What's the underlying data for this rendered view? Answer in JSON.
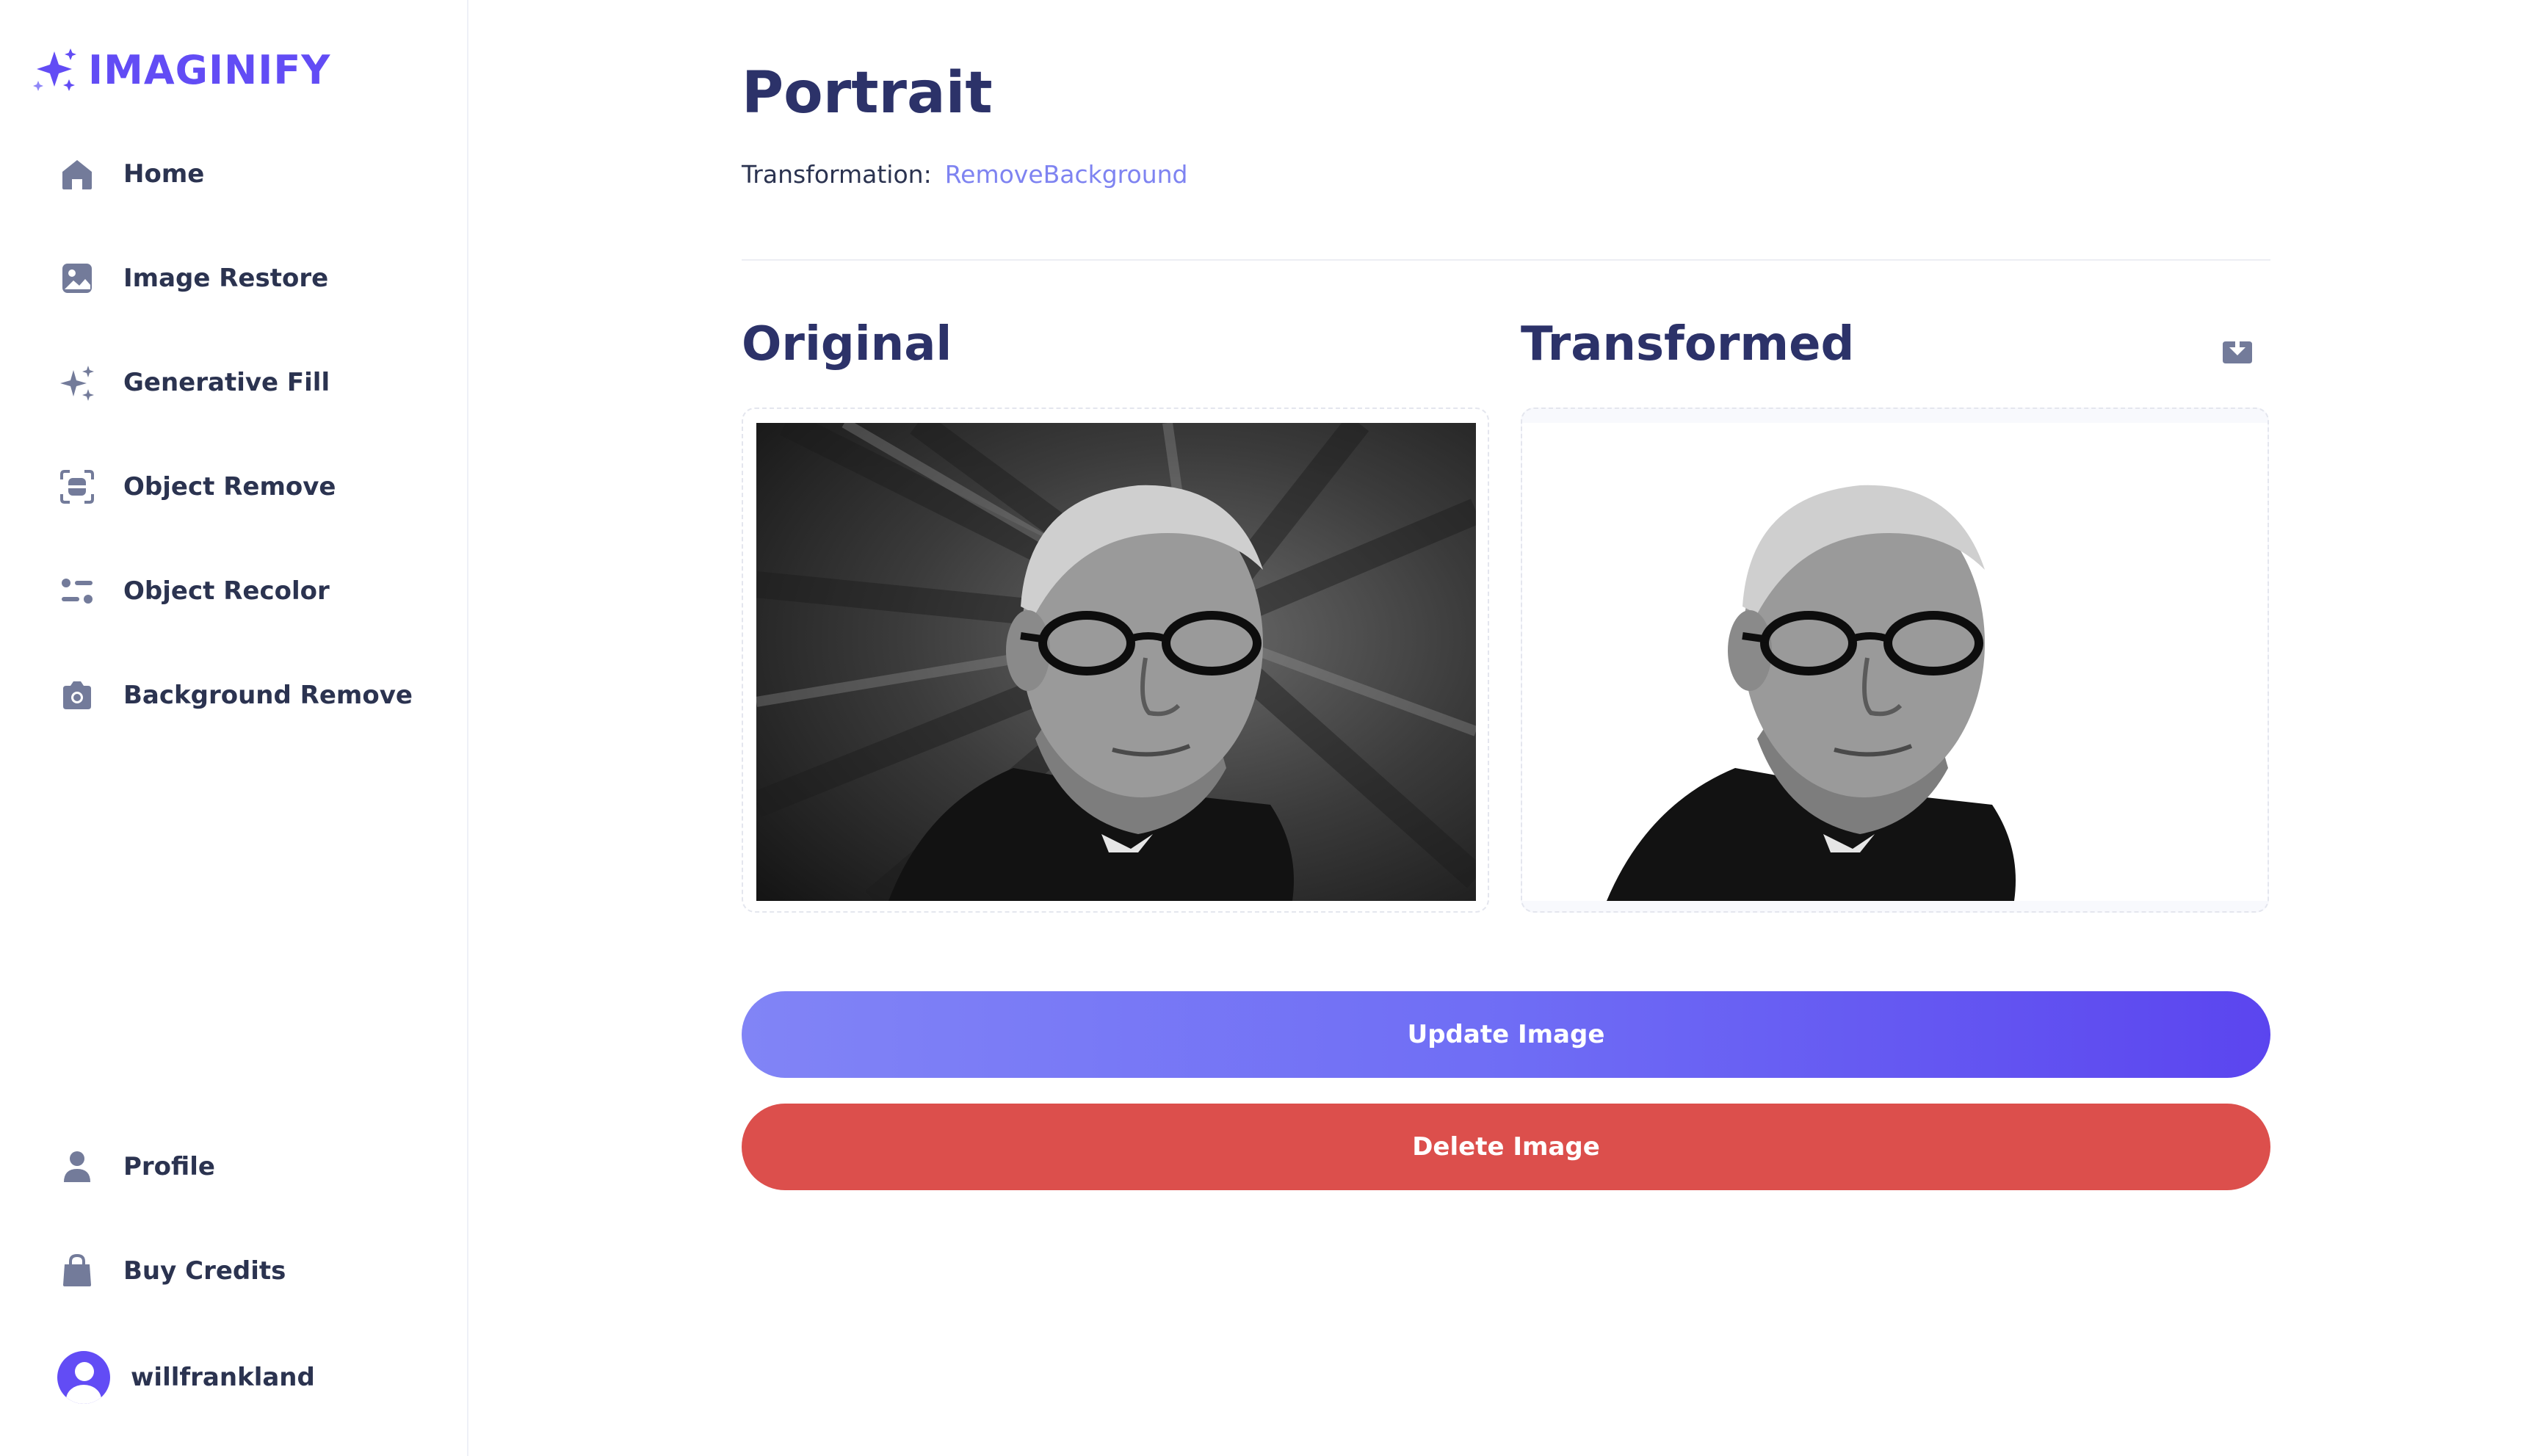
{
  "app": {
    "name": "IMAGINIFY",
    "brand_color": "#624cf5"
  },
  "sidebar": {
    "items": [
      {
        "label": "Home",
        "icon": "home-icon"
      },
      {
        "label": "Image Restore",
        "icon": "image-icon"
      },
      {
        "label": "Generative Fill",
        "icon": "stars-icon"
      },
      {
        "label": "Object Remove",
        "icon": "scan-icon"
      },
      {
        "label": "Object Recolor",
        "icon": "filter-icon"
      },
      {
        "label": "Background Remove",
        "icon": "camera-icon"
      }
    ],
    "bottom_items": [
      {
        "label": "Profile",
        "icon": "user-icon"
      },
      {
        "label": "Buy Credits",
        "icon": "bag-icon"
      }
    ],
    "user": {
      "name": "willfrankland",
      "icon": "avatar-icon"
    }
  },
  "main": {
    "title": "Portrait",
    "transformation_label": "Transformation:",
    "transformation_value": "RemoveBackground",
    "original_title": "Original",
    "transformed_title": "Transformed",
    "download_icon": "download-icon",
    "update_button": "Update Image",
    "delete_button": "Delete Image",
    "colors": {
      "title": "#2c3269",
      "accent_link": "#7e83f1",
      "update_gradient_start": "#8184f6",
      "update_gradient_end": "#5b45ef",
      "delete": "#dc4f4c"
    }
  }
}
